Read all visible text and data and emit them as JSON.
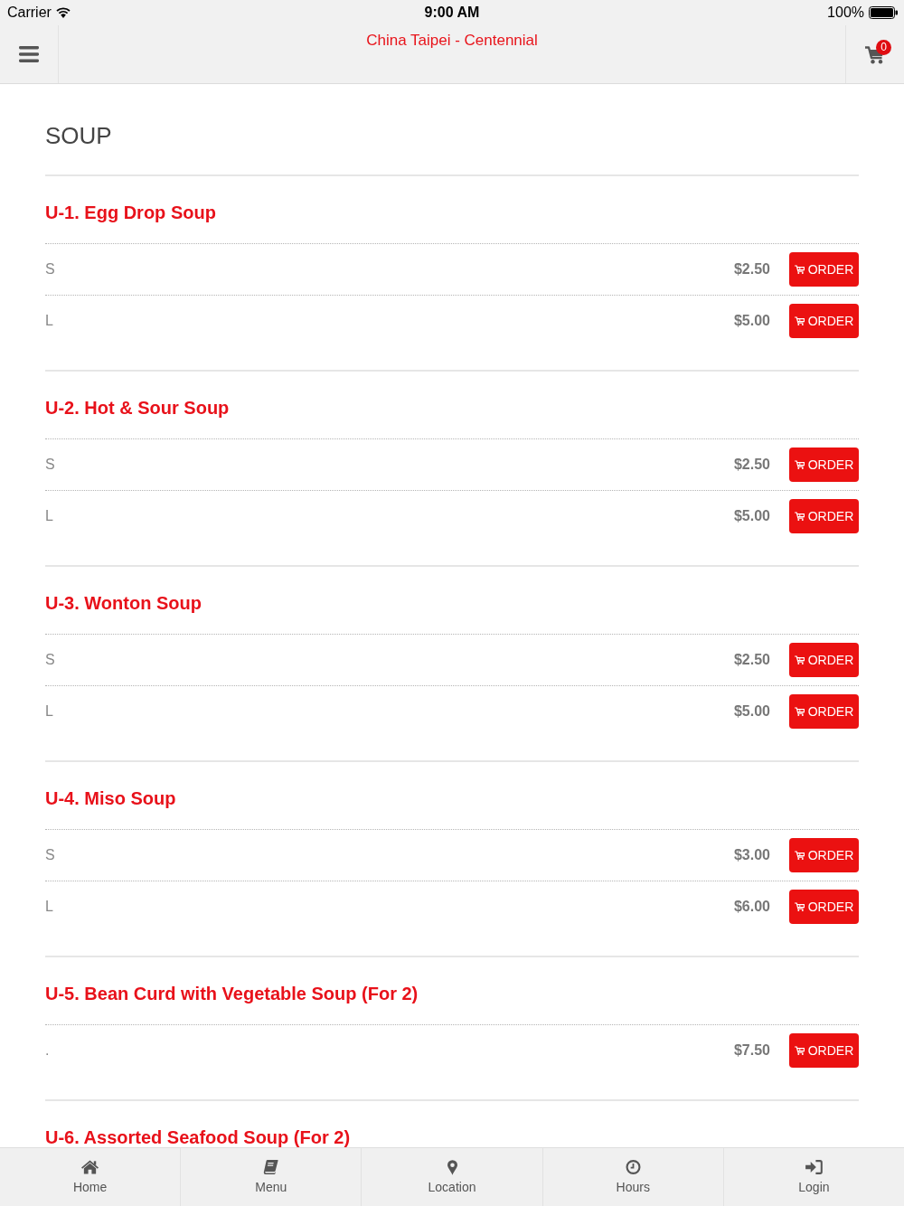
{
  "status_bar": {
    "carrier": "Carrier",
    "time": "9:00 AM",
    "battery": "100%"
  },
  "header": {
    "title": "China Taipei - Centennial",
    "cart_count": "0"
  },
  "category": {
    "title": "SOUP"
  },
  "items": [
    {
      "name": "U-1. Egg Drop Soup",
      "options": [
        {
          "size": "S",
          "price": "$2.50",
          "action": "ORDER"
        },
        {
          "size": "L",
          "price": "$5.00",
          "action": "ORDER"
        }
      ]
    },
    {
      "name": "U-2. Hot & Sour Soup",
      "options": [
        {
          "size": "S",
          "price": "$2.50",
          "action": "ORDER"
        },
        {
          "size": "L",
          "price": "$5.00",
          "action": "ORDER"
        }
      ]
    },
    {
      "name": "U-3. Wonton Soup",
      "options": [
        {
          "size": "S",
          "price": "$2.50",
          "action": "ORDER"
        },
        {
          "size": "L",
          "price": "$5.00",
          "action": "ORDER"
        }
      ]
    },
    {
      "name": "U-4. Miso Soup",
      "options": [
        {
          "size": "S",
          "price": "$3.00",
          "action": "ORDER"
        },
        {
          "size": "L",
          "price": "$6.00",
          "action": "ORDER"
        }
      ]
    },
    {
      "name": "U-5. Bean Curd with Vegetable Soup (For 2)",
      "options": [
        {
          "size": ".",
          "price": "$7.50",
          "action": "ORDER"
        }
      ]
    },
    {
      "name": "U-6. Assorted Seafood Soup (For 2)"
    }
  ],
  "tabs": [
    {
      "kind": "home",
      "label": "Home"
    },
    {
      "kind": "menu",
      "label": "Menu"
    },
    {
      "kind": "location",
      "label": "Location"
    },
    {
      "kind": "hours",
      "label": "Hours"
    },
    {
      "kind": "login",
      "label": "Login"
    }
  ]
}
